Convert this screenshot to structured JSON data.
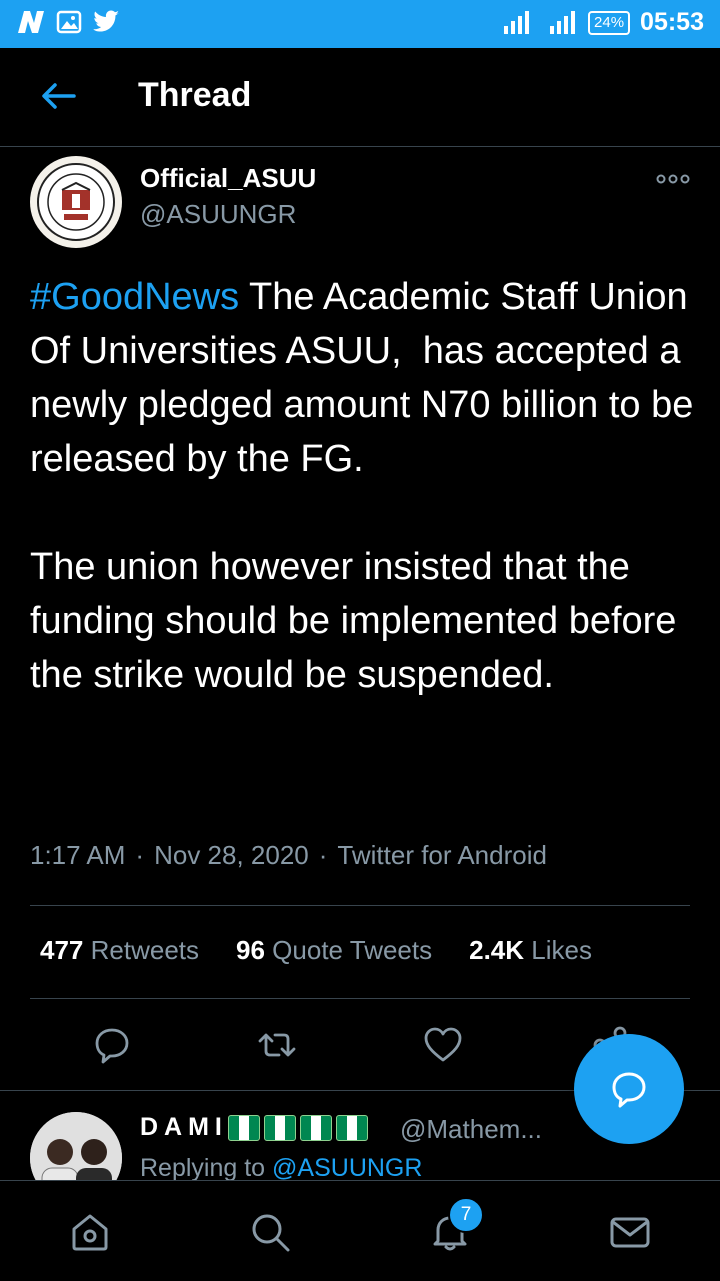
{
  "status_bar": {
    "left_icons": [
      "n-app-icon",
      "image-icon",
      "twitter-bird-icon"
    ],
    "battery": "24%",
    "time": "05:53"
  },
  "header": {
    "title": "Thread",
    "back_icon": "arrow-left-icon"
  },
  "tweet": {
    "author_name": "Official_ASUU",
    "author_handle": "@ASUUNGR",
    "hashtag": "#GoodNews",
    "text_part1": " The Academic Staff Union Of Universities ASUU,  has accepted a newly pledged amount N70 billion to be released by the FG.\n\nThe union however insisted that the funding should be implemented before the strike would be suspended.",
    "time": "1:17 AM",
    "date": "Nov 28, 2020",
    "source": "Twitter for Android",
    "sep": "·",
    "stats": {
      "retweets_count": "477",
      "retweets_label": "Retweets",
      "quotes_count": "96",
      "quotes_label": "Quote Tweets",
      "likes_count": "2.4K",
      "likes_label": "Likes"
    }
  },
  "reply": {
    "author_name": "DAMI",
    "author_handle": "@Mathem...",
    "replying_prefix": "Replying to ",
    "replying_to": "@ASUUNGR"
  },
  "bottom_nav": {
    "notifications_badge": "7"
  },
  "colors": {
    "accent": "#1da1f2",
    "secondary_text": "#8899a6",
    "background": "#000000",
    "divider": "#38444d"
  }
}
